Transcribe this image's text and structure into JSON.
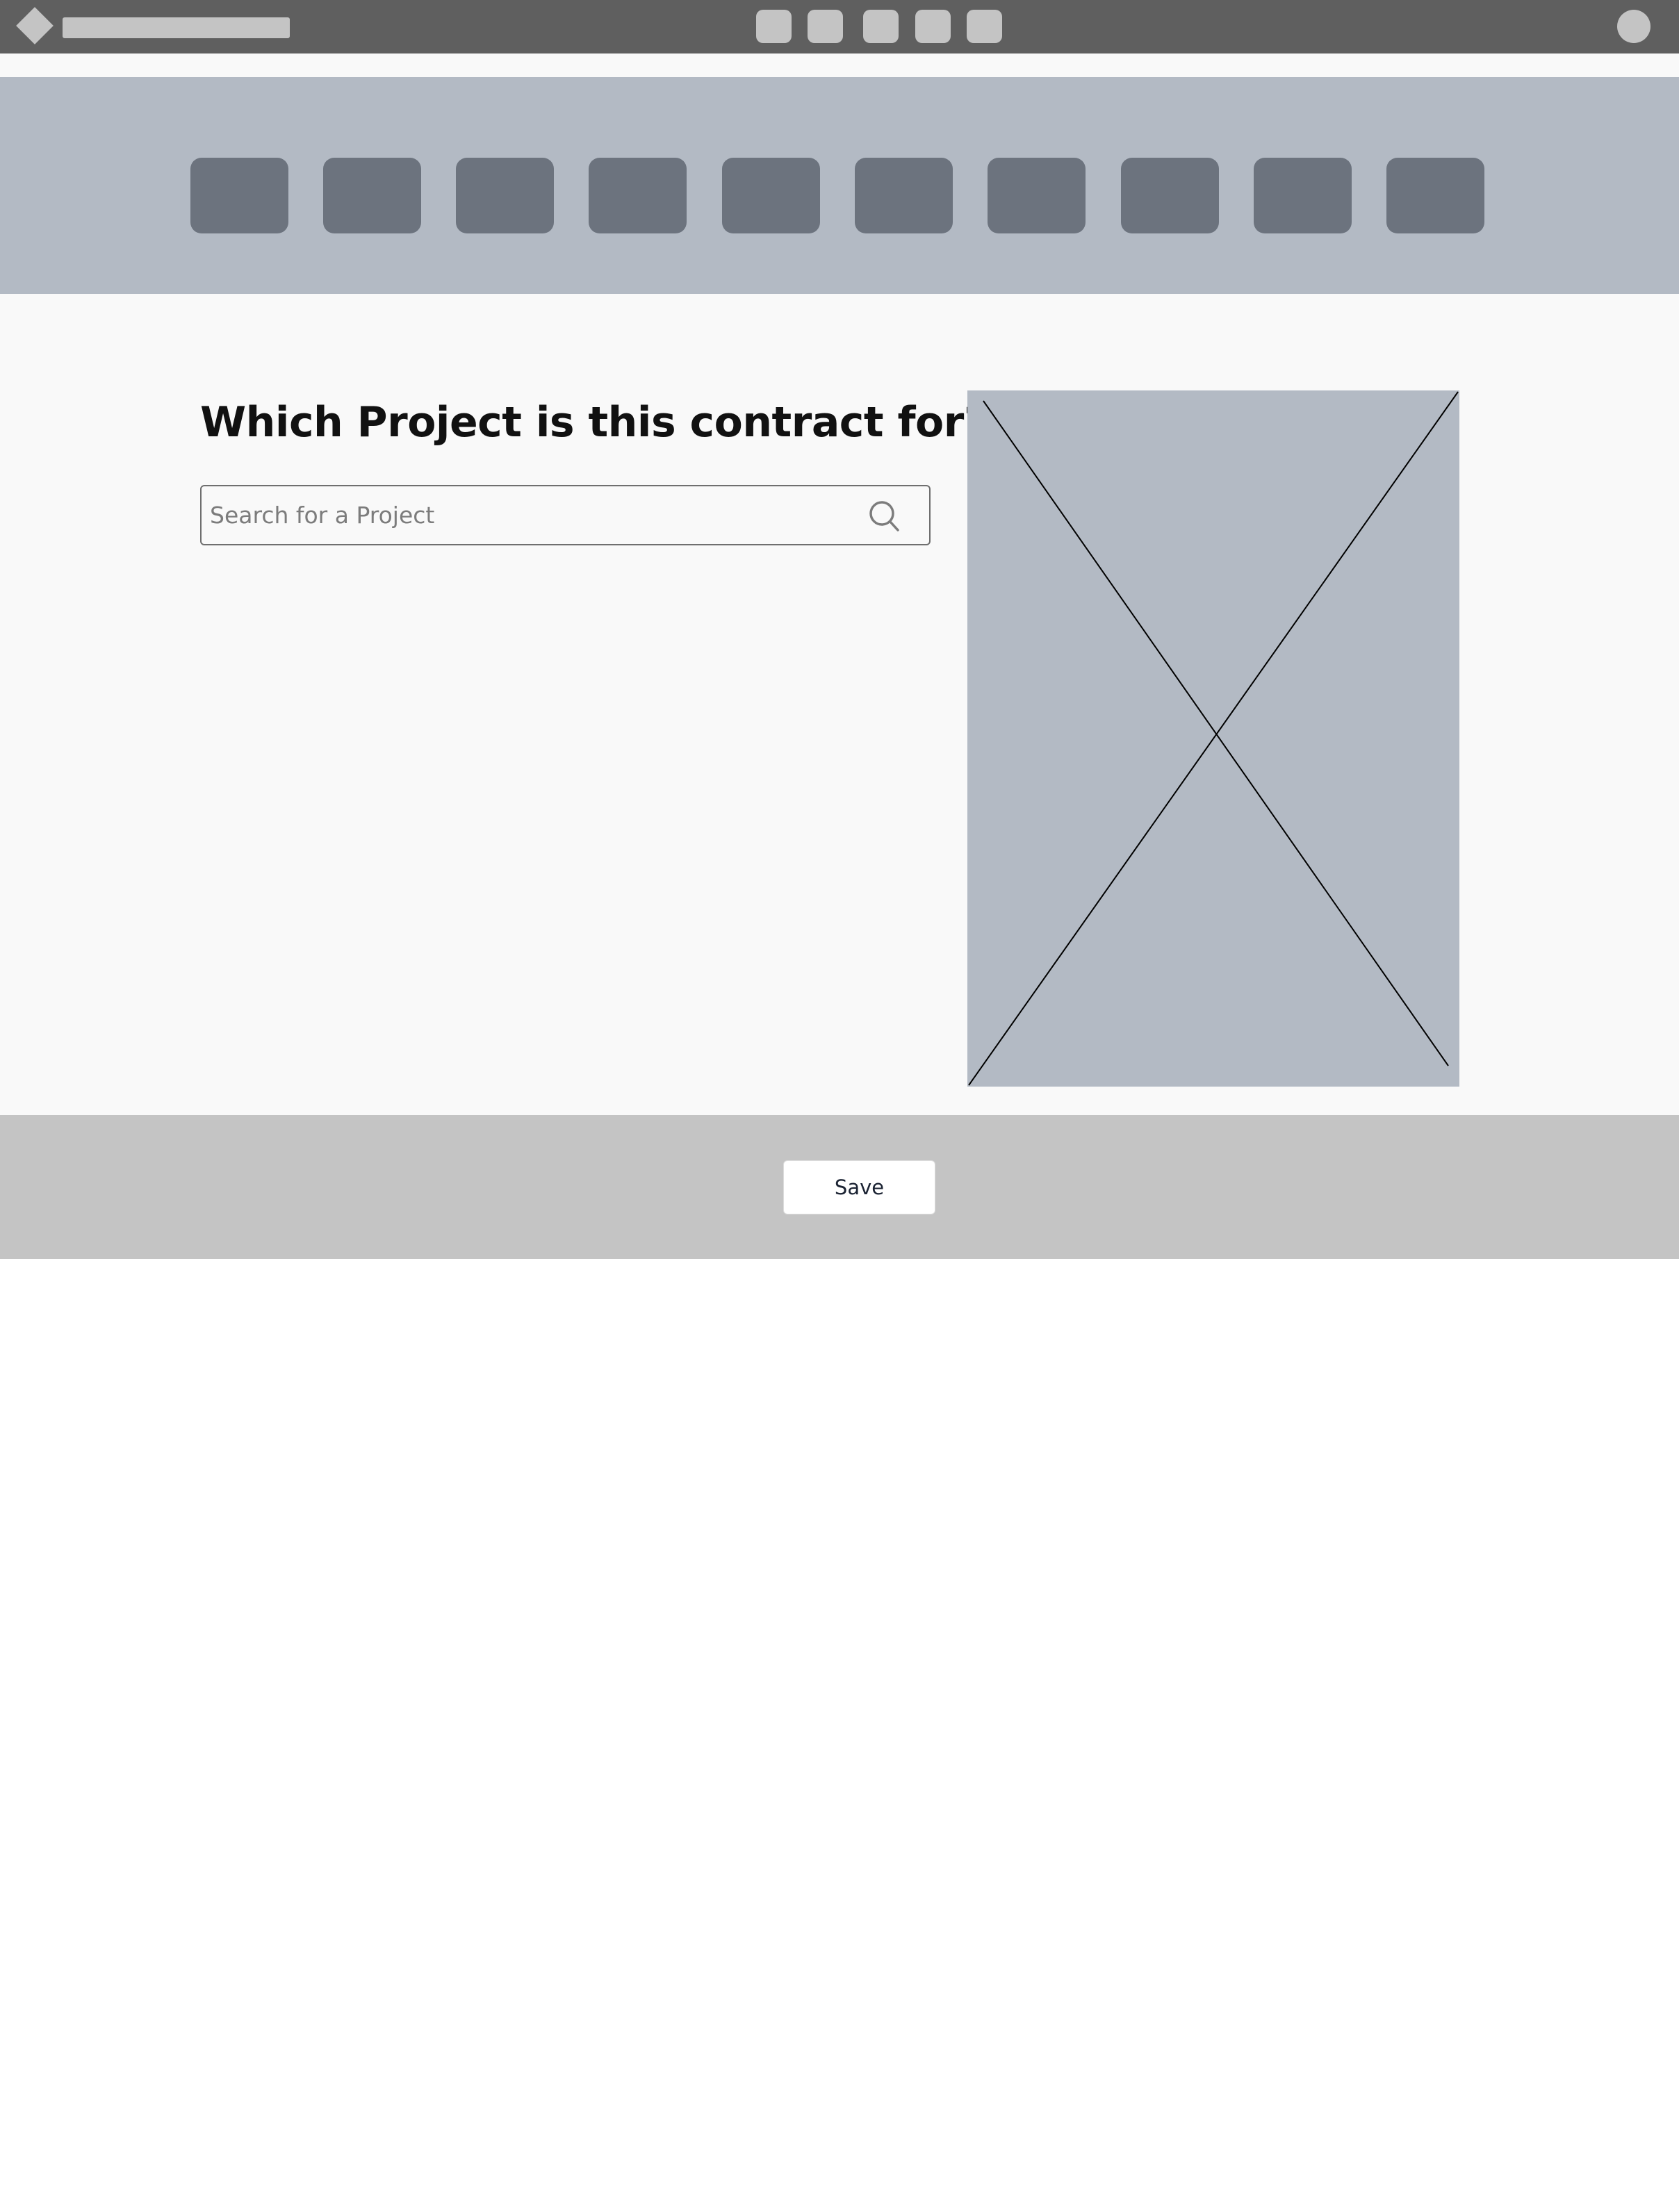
{
  "header": {
    "logo_icon": "diamond-logo-icon",
    "nav_items": [
      "nav-1",
      "nav-2",
      "nav-3",
      "nav-4",
      "nav-5"
    ],
    "avatar_icon": "user-avatar-icon"
  },
  "tiles": [
    "tile-1",
    "tile-2",
    "tile-3",
    "tile-4",
    "tile-5",
    "tile-6",
    "tile-7",
    "tile-8",
    "tile-9",
    "tile-10"
  ],
  "main": {
    "question": "Which Project is this contract for?",
    "search": {
      "placeholder": "Search for a Project",
      "value": "",
      "icon": "search-icon"
    },
    "image_icon": "image-placeholder-icon"
  },
  "footer": {
    "save_label": "Save"
  },
  "colors": {
    "topbar": "#5f5f5f",
    "placeholder_light": "#c4c4c4",
    "band": "#b3bac4",
    "tile": "#6c737e",
    "content_bg": "#f9f9f9",
    "footer": "#c4c4c4"
  }
}
